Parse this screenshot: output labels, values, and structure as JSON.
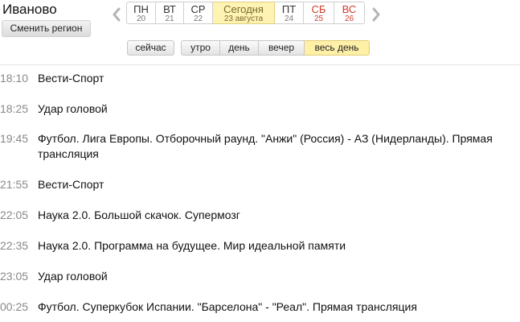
{
  "region": {
    "name": "Иваново",
    "change_label": "Сменить регион"
  },
  "days": [
    {
      "name": "ПН",
      "date": "20",
      "weekend": false,
      "today": false
    },
    {
      "name": "ВТ",
      "date": "21",
      "weekend": false,
      "today": false
    },
    {
      "name": "СР",
      "date": "22",
      "weekend": false,
      "today": false
    },
    {
      "name": "Сегодня",
      "date": "23 августа",
      "weekend": false,
      "today": true
    },
    {
      "name": "ПТ",
      "date": "24",
      "weekend": false,
      "today": false
    },
    {
      "name": "СБ",
      "date": "25",
      "weekend": true,
      "today": false
    },
    {
      "name": "ВС",
      "date": "26",
      "weekend": true,
      "today": false
    }
  ],
  "periods": {
    "now_label": "сейчас",
    "items": [
      {
        "label": "утро",
        "active": false
      },
      {
        "label": "день",
        "active": false
      },
      {
        "label": "вечер",
        "active": false
      },
      {
        "label": "весь день",
        "active": true
      }
    ]
  },
  "programs": [
    {
      "time": "18:10",
      "title": "Вести-Спорт"
    },
    {
      "time": "18:25",
      "title": "Удар головой"
    },
    {
      "time": "19:45",
      "title": "Футбол. Лига Европы. Отборочный раунд. \"Анжи\" (Россия) - АЗ (Нидерланды). Прямая трансляция"
    },
    {
      "time": "21:55",
      "title": "Вести-Спорт"
    },
    {
      "time": "22:05",
      "title": "Наука 2.0. Большой скачок. Супермозг"
    },
    {
      "time": "22:35",
      "title": "Наука 2.0. Программа на будущее. Мир идеальной памяти"
    },
    {
      "time": "23:05",
      "title": "Удар головой"
    },
    {
      "time": "00:25",
      "title": "Футбол. Суперкубок Испании. \"Барселона\" - \"Реал\". Прямая трансляция"
    }
  ],
  "colors": {
    "today_bg": "#fff3b3",
    "weekend": "#d23b2d",
    "active_period_bg": "#fff0a8"
  }
}
